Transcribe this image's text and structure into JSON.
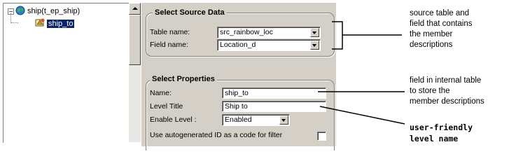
{
  "tree": {
    "expand_glyph": "⊟",
    "root_label": "ship(t_ep_ship)",
    "child_label": "ship_to"
  },
  "source_section": {
    "title": "Select Source Data",
    "table_label": "Table name:",
    "table_value": "src_rainbow_loc",
    "field_label": "Field name:",
    "field_value": "Location_d"
  },
  "properties_section": {
    "title": "Select  Properties",
    "name_label": "Name:",
    "name_value": "ship_to",
    "level_title_label": "Level Title",
    "level_title_value": "Ship to",
    "enable_level_label": "Enable Level :",
    "enable_level_value": "Enabled",
    "autogen_label": "Use autogenerated ID as a code for filter",
    "autogen_checked": false
  },
  "annotations": {
    "source_note": "source table and\nfield that contains\nthe  member\ndescriptions",
    "field_note": "field in internal table\nto store the\nmember descriptions",
    "title_note": "user-friendly\nlevel  name"
  },
  "icons": {
    "root": "globe-icon",
    "child": "level-icon",
    "dropdown": "chevron-down-icon",
    "scroll_up": "scroll-up-icon"
  }
}
